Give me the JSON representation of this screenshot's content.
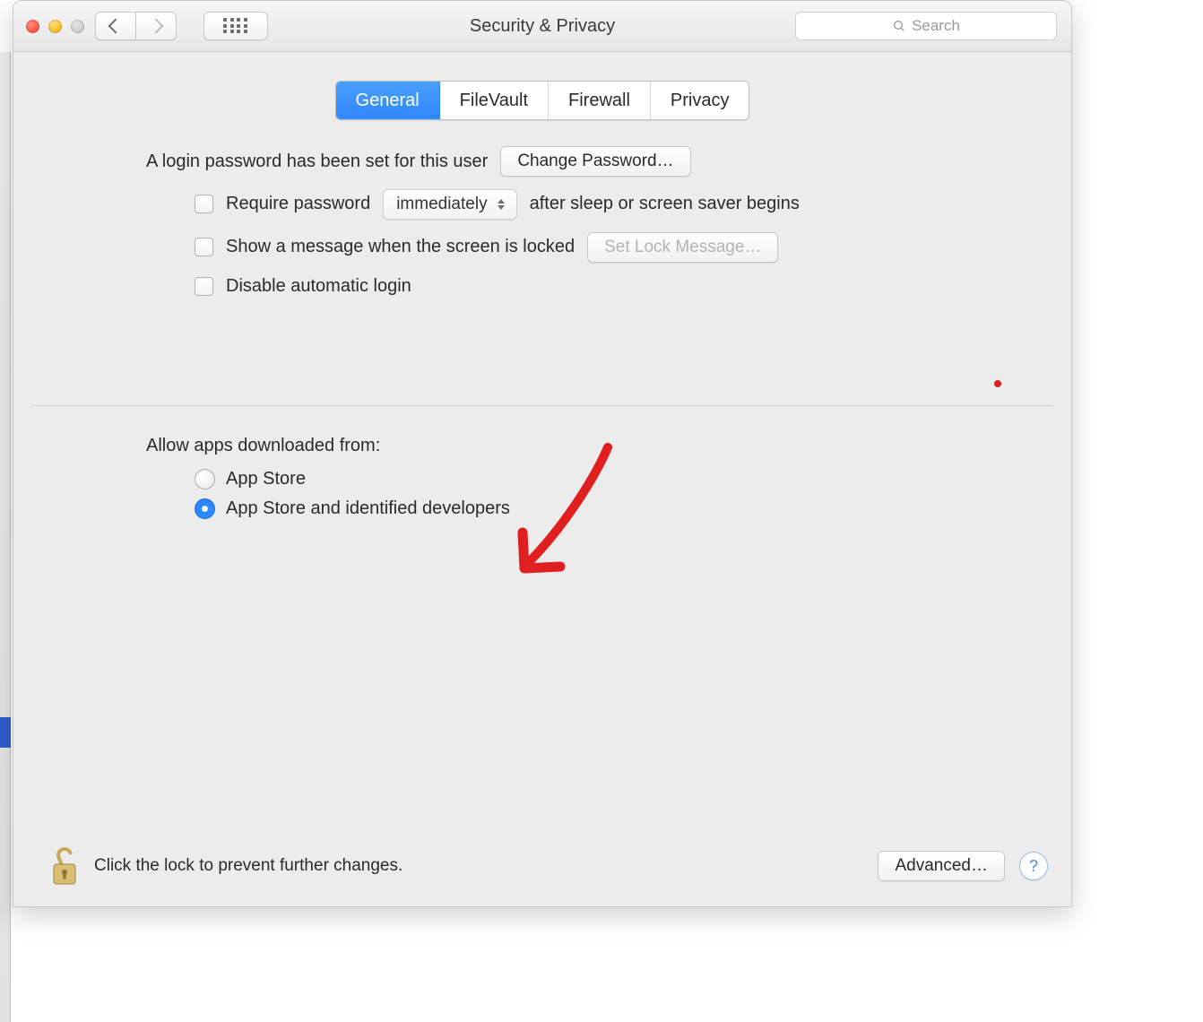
{
  "window": {
    "title": "Security & Privacy",
    "search_placeholder": "Search"
  },
  "tabs": [
    {
      "label": "General",
      "active": true
    },
    {
      "label": "FileVault",
      "active": false
    },
    {
      "label": "Firewall",
      "active": false
    },
    {
      "label": "Privacy",
      "active": false
    }
  ],
  "general": {
    "login_password_text": "A login password has been set for this user",
    "change_password_label": "Change Password…",
    "require_password_label": "Require password",
    "require_password_delay": "immediately",
    "require_password_suffix": "after sleep or screen saver begins",
    "lock_message_checkbox_label": "Show a message when the screen is locked",
    "set_lock_message_label": "Set Lock Message…",
    "disable_auto_login_label": "Disable automatic login",
    "allow_apps_heading": "Allow apps downloaded from:",
    "allow_apps_options": [
      {
        "label": "App Store",
        "selected": false
      },
      {
        "label": "App Store and identified developers",
        "selected": true
      }
    ]
  },
  "footer": {
    "lock_text": "Click the lock to prevent further changes.",
    "advanced_label": "Advanced…",
    "help_label": "?"
  }
}
